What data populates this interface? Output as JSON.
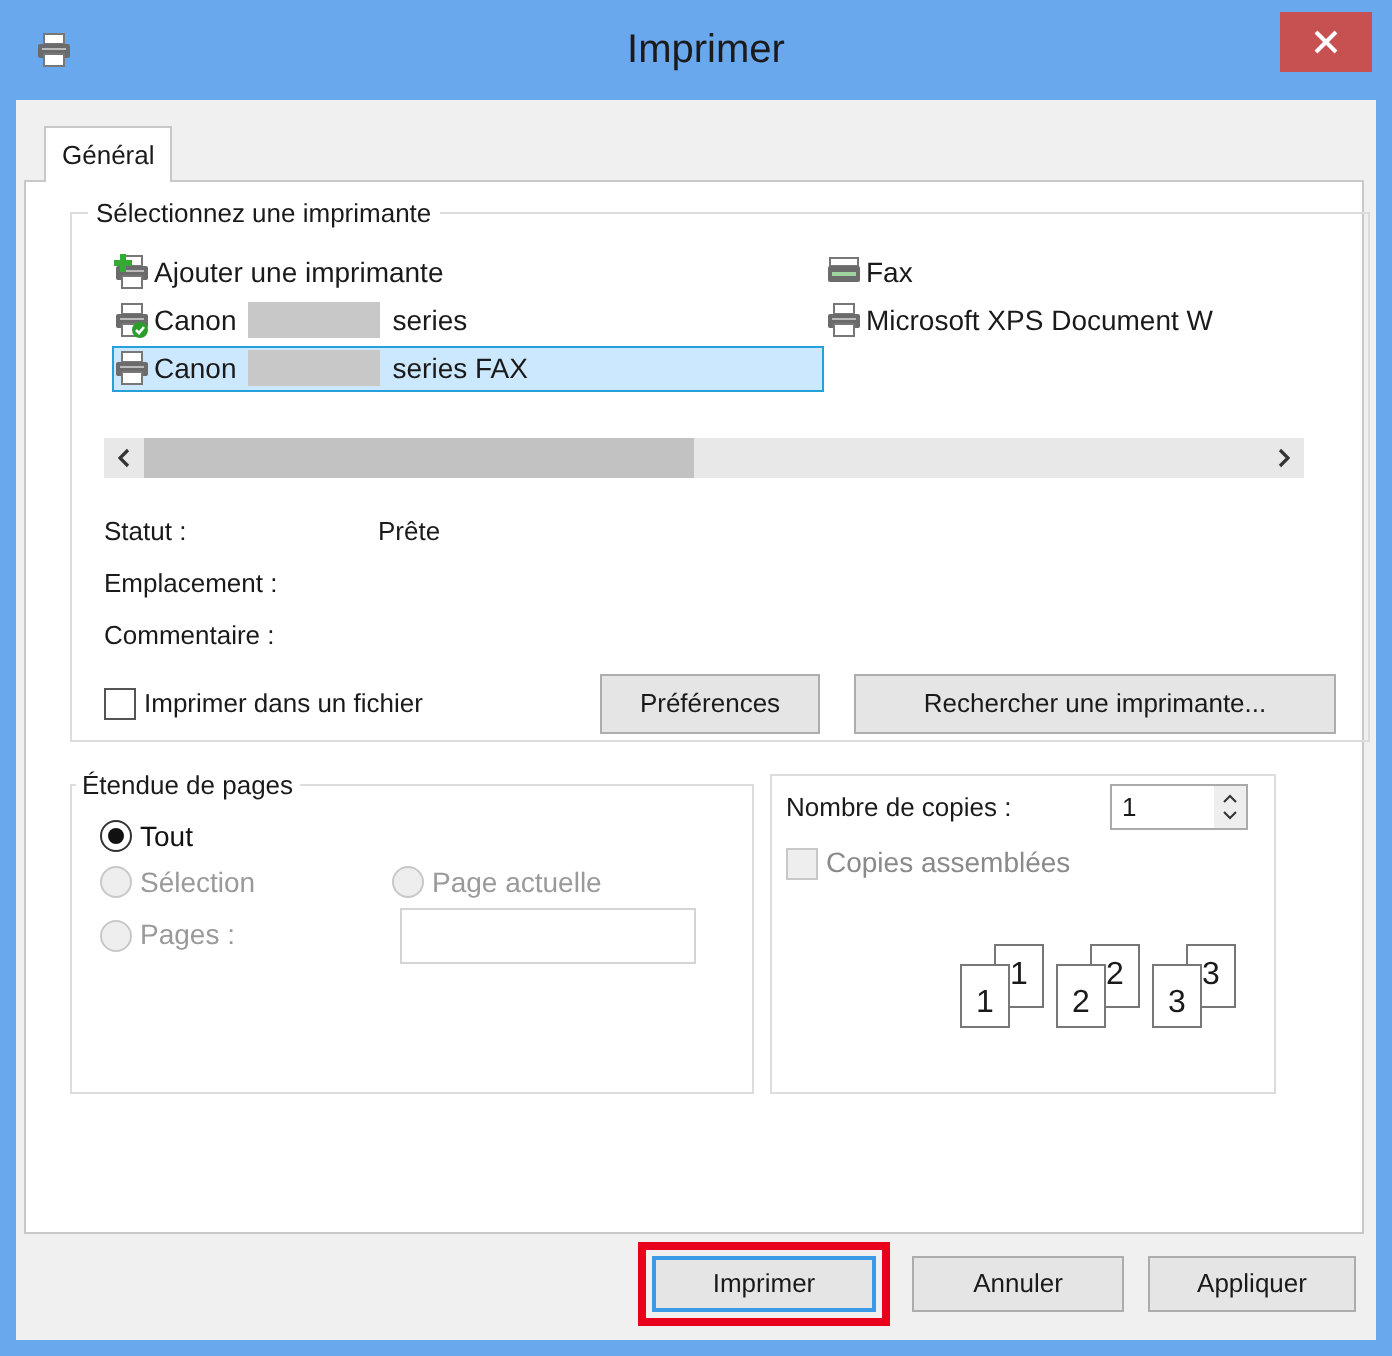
{
  "window": {
    "title": "Imprimer"
  },
  "tabs": [
    {
      "label": "Général",
      "selected": true
    }
  ],
  "printer_group": {
    "title": "Sélectionnez une imprimante",
    "printers": [
      {
        "kind": "add",
        "name": "Ajouter une imprimante",
        "redacted": false,
        "default": false,
        "selected": false
      },
      {
        "kind": "printer",
        "name": "Canon",
        "suffix": "series",
        "redacted": true,
        "default": true,
        "selected": false
      },
      {
        "kind": "printer",
        "name": "Canon",
        "suffix": "series FAX",
        "redacted": true,
        "default": false,
        "selected": true
      },
      {
        "kind": "fax",
        "name": "Fax",
        "redacted": false,
        "default": false,
        "selected": false
      },
      {
        "kind": "printer",
        "name": "Microsoft XPS Document W",
        "redacted": false,
        "default": false,
        "selected": false
      }
    ],
    "details": [
      {
        "label": "Statut :",
        "value": "Prête"
      },
      {
        "label": "Emplacement :"
      },
      {
        "label": "Commentaire :"
      }
    ],
    "print_to_file": {
      "label": "Imprimer dans un fichier",
      "checked": false
    },
    "buttons": [
      "Préférences",
      "Rechercher une imprimante..."
    ]
  },
  "page_range": {
    "title": "Étendue de pages",
    "options": [
      {
        "label": "Tout",
        "selected": true,
        "disabled": false
      },
      {
        "label": "Sélection",
        "selected": false,
        "disabled": true
      },
      {
        "label": "Page actuelle",
        "selected": false,
        "disabled": true
      },
      {
        "label": "Pages :",
        "selected": false,
        "disabled": true
      }
    ],
    "pages_field": {
      "disabled": true
    }
  },
  "copies": {
    "label": "Nombre de copies :",
    "value": "1",
    "collate": {
      "label": "Copies assemblées",
      "checked": false,
      "disabled": true
    },
    "collate_pages": [
      {
        "front": "1",
        "back": "1"
      },
      {
        "front": "2",
        "back": "2"
      },
      {
        "front": "3",
        "back": "3"
      }
    ]
  },
  "footer_buttons": [
    {
      "label": "Imprimer",
      "focused": true,
      "highlighted": true
    },
    {
      "label": "Annuler",
      "focused": false,
      "highlighted": false
    },
    {
      "label": "Appliquer",
      "focused": false,
      "highlighted": false
    }
  ]
}
